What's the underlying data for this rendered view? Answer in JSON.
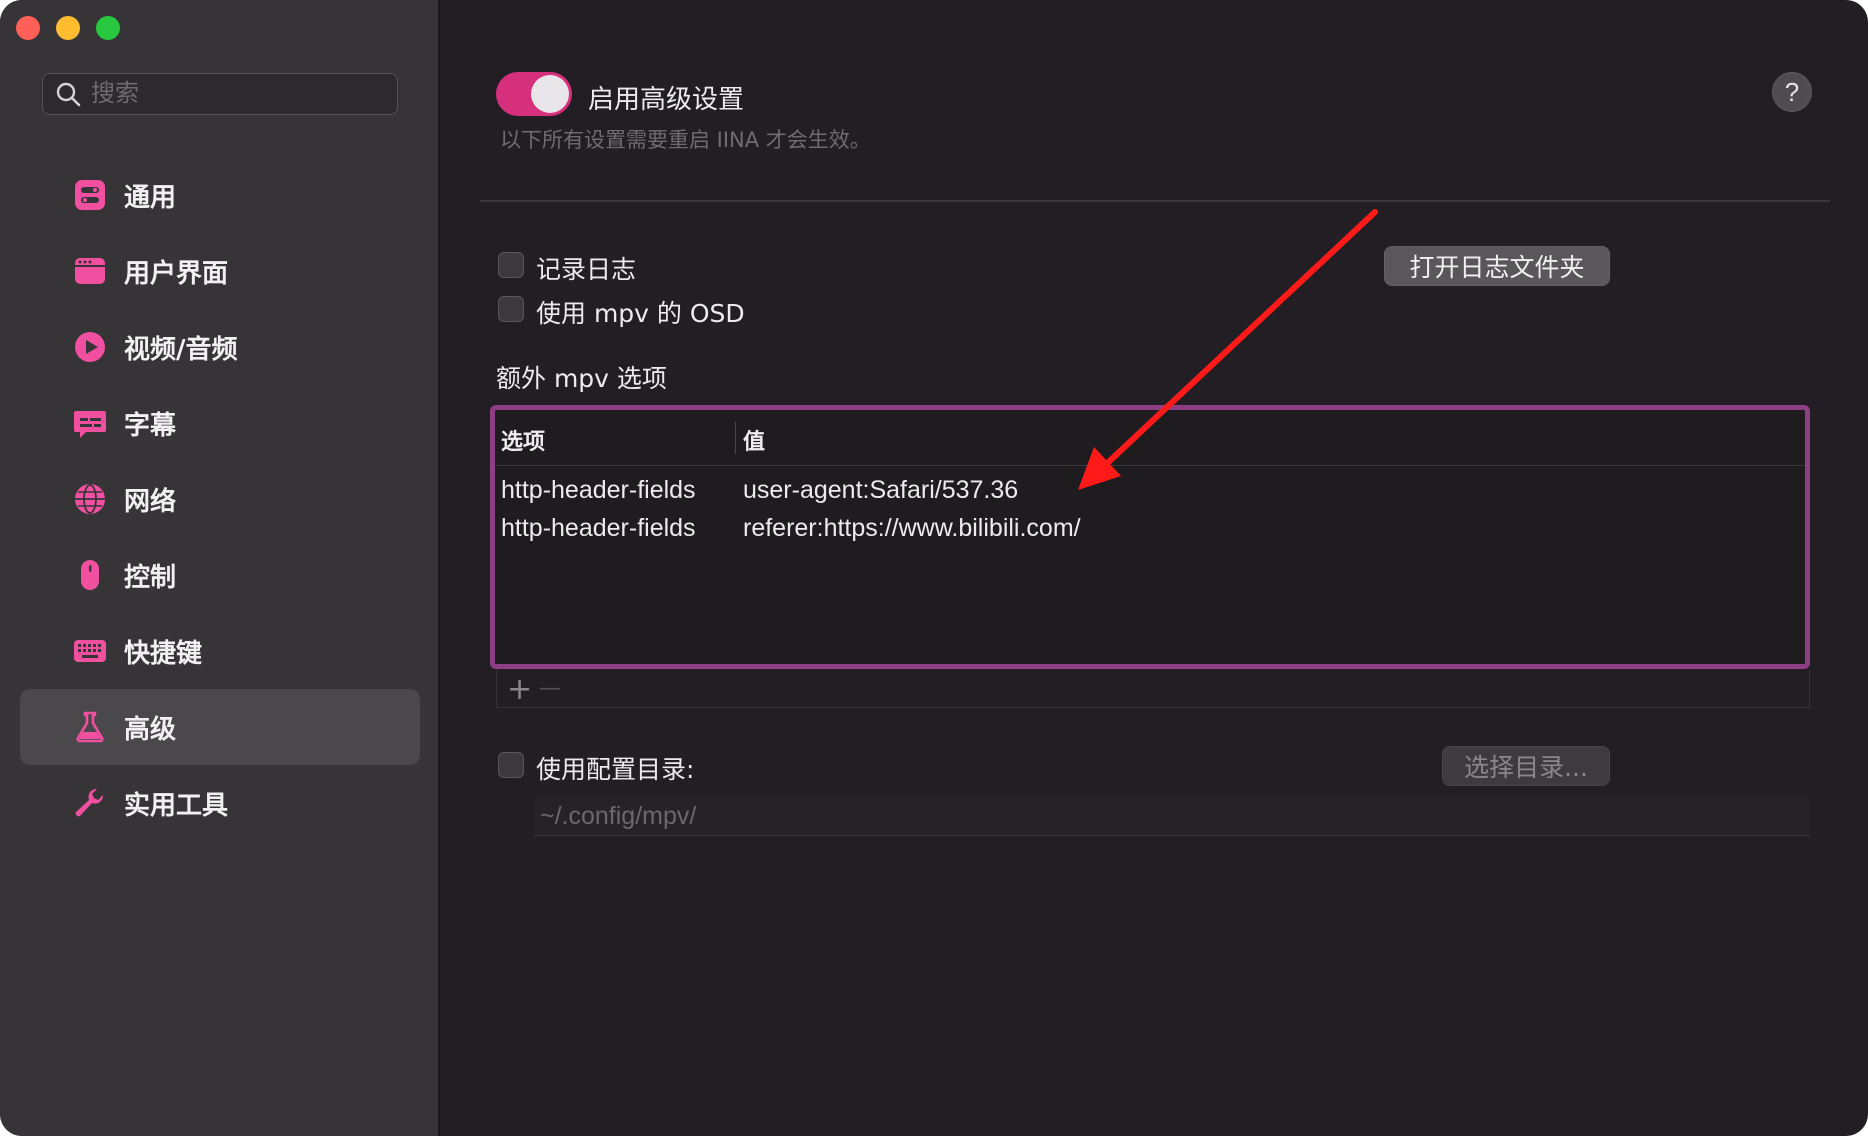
{
  "colors": {
    "accent": "#d6307d",
    "sidebar_icon": "#f0509f",
    "highlight_border": "#8e3e84",
    "annotation_arrow": "#ff1a1a"
  },
  "search": {
    "placeholder": "搜索"
  },
  "sidebar": {
    "items": [
      {
        "label": "通用",
        "icon": "general-icon"
      },
      {
        "label": "用户界面",
        "icon": "ui-icon"
      },
      {
        "label": "视频/音频",
        "icon": "play-icon"
      },
      {
        "label": "字幕",
        "icon": "subtitle-icon"
      },
      {
        "label": "网络",
        "icon": "globe-icon"
      },
      {
        "label": "控制",
        "icon": "mouse-icon"
      },
      {
        "label": "快捷键",
        "icon": "keyboard-icon"
      },
      {
        "label": "高级",
        "icon": "flask-icon",
        "active": true
      },
      {
        "label": "实用工具",
        "icon": "wrench-icon"
      }
    ]
  },
  "advanced": {
    "toggle_label": "启用高级设置",
    "toggle_on": true,
    "hint": "以下所有设置需要重启 IINA 才会生效。",
    "help": "?",
    "log_label": "记录日志",
    "osd_label": "使用 mpv 的 OSD",
    "open_log_button": "打开日志文件夹",
    "extra_options_title": "额外 mpv 选项",
    "table": {
      "headers": [
        "选项",
        "值"
      ],
      "rows": [
        [
          "http-header-fields",
          "user-agent:Safari/537.36"
        ],
        [
          "http-header-fields",
          "referer:https://www.bilibili.com/"
        ]
      ]
    },
    "add_symbol": "+",
    "remove_symbol": "—",
    "config_dir_label": "使用配置目录:",
    "choose_dir_button": "选择目录...",
    "config_dir_placeholder": "~/.config/mpv/"
  }
}
